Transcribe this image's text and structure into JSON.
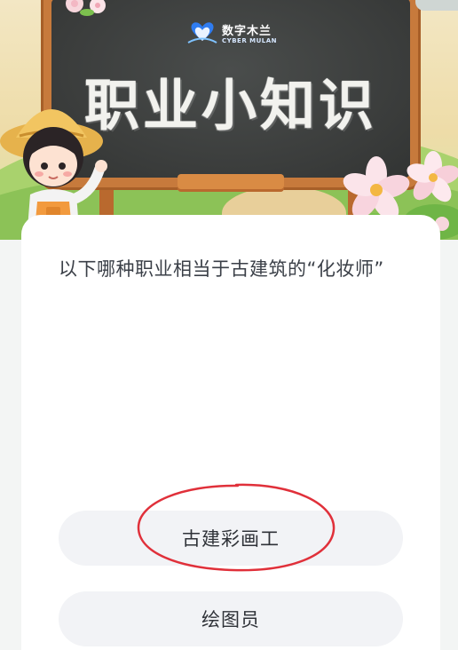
{
  "banner": {
    "logo_cn": "数字木兰",
    "logo_en": "CYBER MULAN",
    "title": "职业小知识"
  },
  "quiz": {
    "question": "以下哪种职业相当于古建筑的“化妆师”",
    "options": [
      {
        "label": "古建彩画工",
        "circled": true
      },
      {
        "label": "绘图员",
        "circled": false
      }
    ]
  },
  "colors": {
    "board": "#3a3c3b",
    "board_frame": "#c77a3c",
    "card": "#ffffff",
    "option_bg": "#f2f3f6",
    "circle_annotation": "#e0303a"
  },
  "icons": [
    "cyber-mulan-logo-icon",
    "girl-character-illustration",
    "flower-decoration"
  ]
}
